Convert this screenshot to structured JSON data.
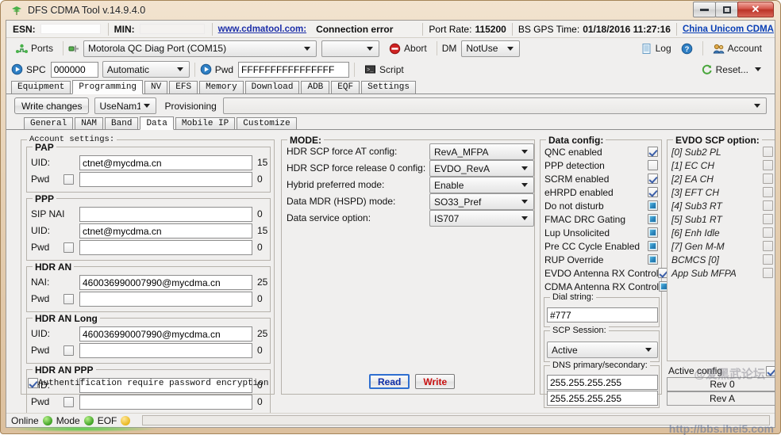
{
  "window": {
    "title": "DFS CDMA Tool v.14.9.4.0",
    "app_icon": "antenna-icon",
    "minimize_label": "",
    "maximize_label": "",
    "close_label": "✕"
  },
  "infobar": {
    "esn_label": "ESN:",
    "esn_value": "",
    "min_label": "MIN:",
    "min_value": "",
    "site_link": "www.cdmatool.com:",
    "status": "Connection error",
    "port_rate_label": "Port Rate:",
    "port_rate_value": "115200",
    "bs_gps_label": "BS GPS Time:",
    "bs_gps_value": "01/18/2016 11:27:16",
    "carrier_link": "China Unicom CDMA"
  },
  "toolbar": {
    "ports_label": "Ports",
    "port_combo_value": "Motorola QC Diag Port (COM15)",
    "port_extra_combo_value": "",
    "abort_label": "Abort",
    "dm_label": "DM",
    "dm_combo_value": "NotUse",
    "log_label": "Log",
    "help_label": "?",
    "account_label": "Account"
  },
  "toolbar2": {
    "spc_label": "SPC",
    "spc_value": "000000",
    "spc_mode_value": "Automatic",
    "pwd_label": "Pwd",
    "pwd_value": "FFFFFFFFFFFFFFFF",
    "script_label": "Script",
    "reset_label": "Reset..."
  },
  "main_tabs": [
    {
      "label": "Equipment",
      "active": false
    },
    {
      "label": "Programming",
      "active": true
    },
    {
      "label": "NV",
      "active": false
    },
    {
      "label": "EFS",
      "active": false
    },
    {
      "label": "Memory",
      "active": false
    },
    {
      "label": "Download",
      "active": false
    },
    {
      "label": "ADB",
      "active": false
    },
    {
      "label": "EQF",
      "active": false
    },
    {
      "label": "Settings",
      "active": false
    }
  ],
  "prov_row": {
    "write_changes_label": "Write changes",
    "nam_combo_value": "UseNam1",
    "provisioning_label": "Provisioning",
    "provisioning_combo_value": ""
  },
  "sub_tabs": [
    {
      "label": "General",
      "active": false
    },
    {
      "label": "NAM",
      "active": false
    },
    {
      "label": "Band",
      "active": false
    },
    {
      "label": "Data",
      "active": true
    },
    {
      "label": "Mobile IP",
      "active": false
    },
    {
      "label": "Customize",
      "active": false
    }
  ],
  "account_settings": {
    "title": "Account settings:",
    "groups": [
      {
        "title": "PAP",
        "rows": [
          {
            "label": "UID:",
            "value": "ctnet@mycdma.cn",
            "count": "15",
            "checkbox": null
          },
          {
            "label": "Pwd",
            "value": "",
            "count": "0",
            "checkbox": "unchecked"
          }
        ]
      },
      {
        "title": "PPP",
        "rows": [
          {
            "label": "SIP NAI",
            "value": "",
            "count": "0",
            "checkbox": null
          },
          {
            "label": "UID:",
            "value": "ctnet@mycdma.cn",
            "count": "15",
            "checkbox": null
          },
          {
            "label": "Pwd",
            "value": "",
            "count": "0",
            "checkbox": "unchecked"
          }
        ]
      },
      {
        "title": "HDR AN",
        "rows": [
          {
            "label": "NAI:",
            "value": "460036990007990@mycdma.cn",
            "count": "25",
            "checkbox": null
          },
          {
            "label": "Pwd",
            "value": "",
            "count": "0",
            "checkbox": "unchecked"
          }
        ]
      },
      {
        "title": "HDR AN Long",
        "rows": [
          {
            "label": "UID:",
            "value": "460036990007990@mycdma.cn",
            "count": "25",
            "checkbox": null
          },
          {
            "label": "Pwd",
            "value": "",
            "count": "0",
            "checkbox": "unchecked"
          }
        ]
      },
      {
        "title": "HDR AN PPP",
        "rows": [
          {
            "label": "UID:",
            "value": "",
            "count": "0",
            "checkbox": null
          },
          {
            "label": "Pwd",
            "value": "",
            "count": "0",
            "checkbox": "unchecked"
          }
        ]
      }
    ],
    "auth_checkbox_state": "checked",
    "auth_label": "Authentification require password encryption"
  },
  "mode_panel": {
    "title": "MODE:",
    "rows": [
      {
        "label": "HDR SCP force AT config:",
        "value": "RevA_MFPA"
      },
      {
        "label": "HDR SCP force release 0 config:",
        "value": "EVDO_RevA"
      },
      {
        "label": "Hybrid preferred mode:",
        "value": "Enable"
      },
      {
        "label": "Data MDR (HSPD) mode:",
        "value": "SO33_Pref"
      },
      {
        "label": "Data service option:",
        "value": "IS707"
      }
    ],
    "read_label": "Read",
    "write_label": "Write"
  },
  "data_config": {
    "title": "Data config:",
    "items": [
      {
        "label": "QNC enabled",
        "state": "checked"
      },
      {
        "label": "PPP detection",
        "state": "unchecked"
      },
      {
        "label": "SCRM enabled",
        "state": "checked"
      },
      {
        "label": "eHRPD enabled",
        "state": "checked"
      },
      {
        "label": "Do not disturb",
        "state": "filled"
      },
      {
        "label": "FMAC DRC Gating",
        "state": "filled"
      },
      {
        "label": "Lup Unsolicited",
        "state": "filled"
      },
      {
        "label": "Pre CC Cycle Enabled",
        "state": "filled"
      },
      {
        "label": "RUP Override",
        "state": "filled"
      },
      {
        "label": "EVDO Antenna RX Control",
        "state": "checked"
      },
      {
        "label": "CDMA Antenna RX Control",
        "state": "filled"
      }
    ],
    "dial_string_title": "Dial string:",
    "dial_string_value": "#777",
    "scp_session_title": "SCP Session:",
    "scp_session_value": "Active",
    "dns_title": "DNS primary/secondary:",
    "dns_primary": "255.255.255.255",
    "dns_secondary": "255.255.255.255"
  },
  "evdo_scp": {
    "title": "EVDO SCP option:",
    "items": [
      {
        "label": "[0] Sub2 PL",
        "state": "disabled"
      },
      {
        "label": "[1] EC CH",
        "state": "disabled"
      },
      {
        "label": "[2] EA CH",
        "state": "disabled"
      },
      {
        "label": "[3] EFT CH",
        "state": "disabled"
      },
      {
        "label": "[4] Sub3 RT",
        "state": "disabled"
      },
      {
        "label": "[5] Sub1 RT",
        "state": "disabled"
      },
      {
        "label": "[6] Enh Idle",
        "state": "disabled"
      },
      {
        "label": "[7] Gen M-M",
        "state": "disabled"
      },
      {
        "label": "BCMCS [0]",
        "state": "disabled"
      },
      {
        "label": "App Sub MFPA",
        "state": "disabled"
      }
    ],
    "active_config_label": "Active config",
    "active_config_state": "checked",
    "rev_rows": [
      "Rev 0",
      "Rev A"
    ]
  },
  "statusbar": {
    "online_label": "Online",
    "mode_label": "Mode",
    "eof_label": "EOF"
  },
  "watermark": {
    "text1": "@爱黑武论坛",
    "text2": "http://bbs.ihei5.com"
  },
  "colors": {
    "accent_blue": "#0e2ea8",
    "accent_red": "#c81010",
    "link": "#1c2ea8",
    "frame": "#dcc09e"
  }
}
